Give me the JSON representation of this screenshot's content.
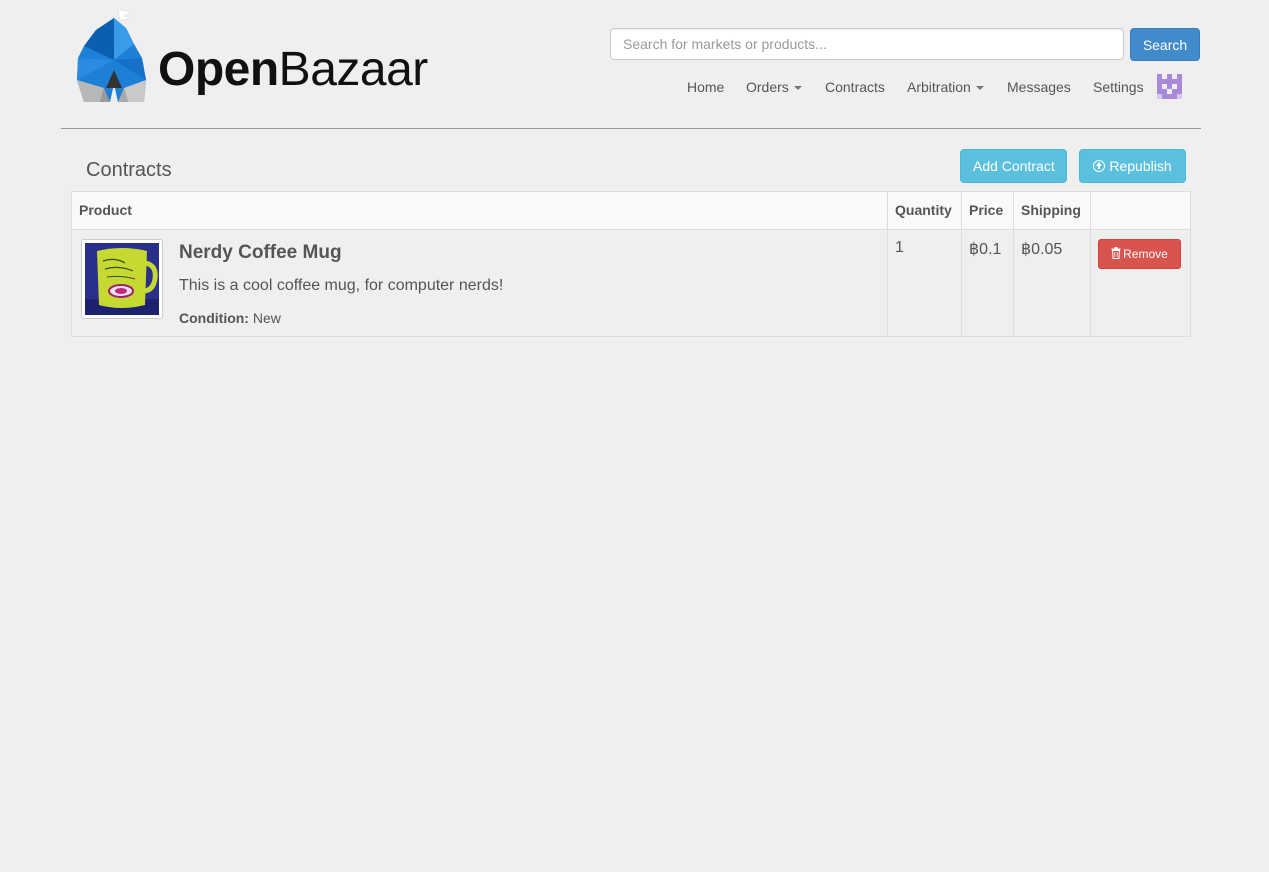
{
  "brand": {
    "name_part1": "Open",
    "name_part2": "Bazaar",
    "logo_colors": {
      "blue": "#1e7fd6",
      "dark_blue": "#0c5fb0",
      "grey": "#b0b0b0"
    }
  },
  "search": {
    "placeholder": "Search for markets or products...",
    "value": "",
    "button_label": "Search"
  },
  "nav": {
    "items": [
      {
        "label": "Home",
        "has_dropdown": false
      },
      {
        "label": "Orders",
        "has_dropdown": true
      },
      {
        "label": "Contracts",
        "has_dropdown": false
      },
      {
        "label": "Arbitration",
        "has_dropdown": true
      },
      {
        "label": "Messages",
        "has_dropdown": false
      },
      {
        "label": "Settings",
        "has_dropdown": false
      }
    ],
    "avatar_icon": "identicon-avatar-icon",
    "avatar_color": "#a98ad8"
  },
  "page": {
    "title": "Contracts",
    "add_button_label": "Add Contract",
    "republish_button_label": "Republish",
    "republish_icon": "circle-arrow-up-icon"
  },
  "table": {
    "headers": {
      "product": "Product",
      "quantity": "Quantity",
      "price": "Price",
      "shipping": "Shipping",
      "actions": ""
    },
    "rows": [
      {
        "name": "Nerdy Coffee Mug",
        "description": "This is a cool coffee mug, for computer nerds!",
        "condition_label": "Condition:",
        "condition_value": "New",
        "quantity": "1",
        "price": "฿0.1",
        "shipping": "฿0.05",
        "remove_label": "Remove",
        "remove_icon": "trash-icon",
        "thumbnail_icon": "coffee-mug-image"
      }
    ]
  },
  "colors": {
    "primary": "#428bca",
    "info": "#5bc0de",
    "danger": "#d9534f",
    "background": "#efefef"
  }
}
